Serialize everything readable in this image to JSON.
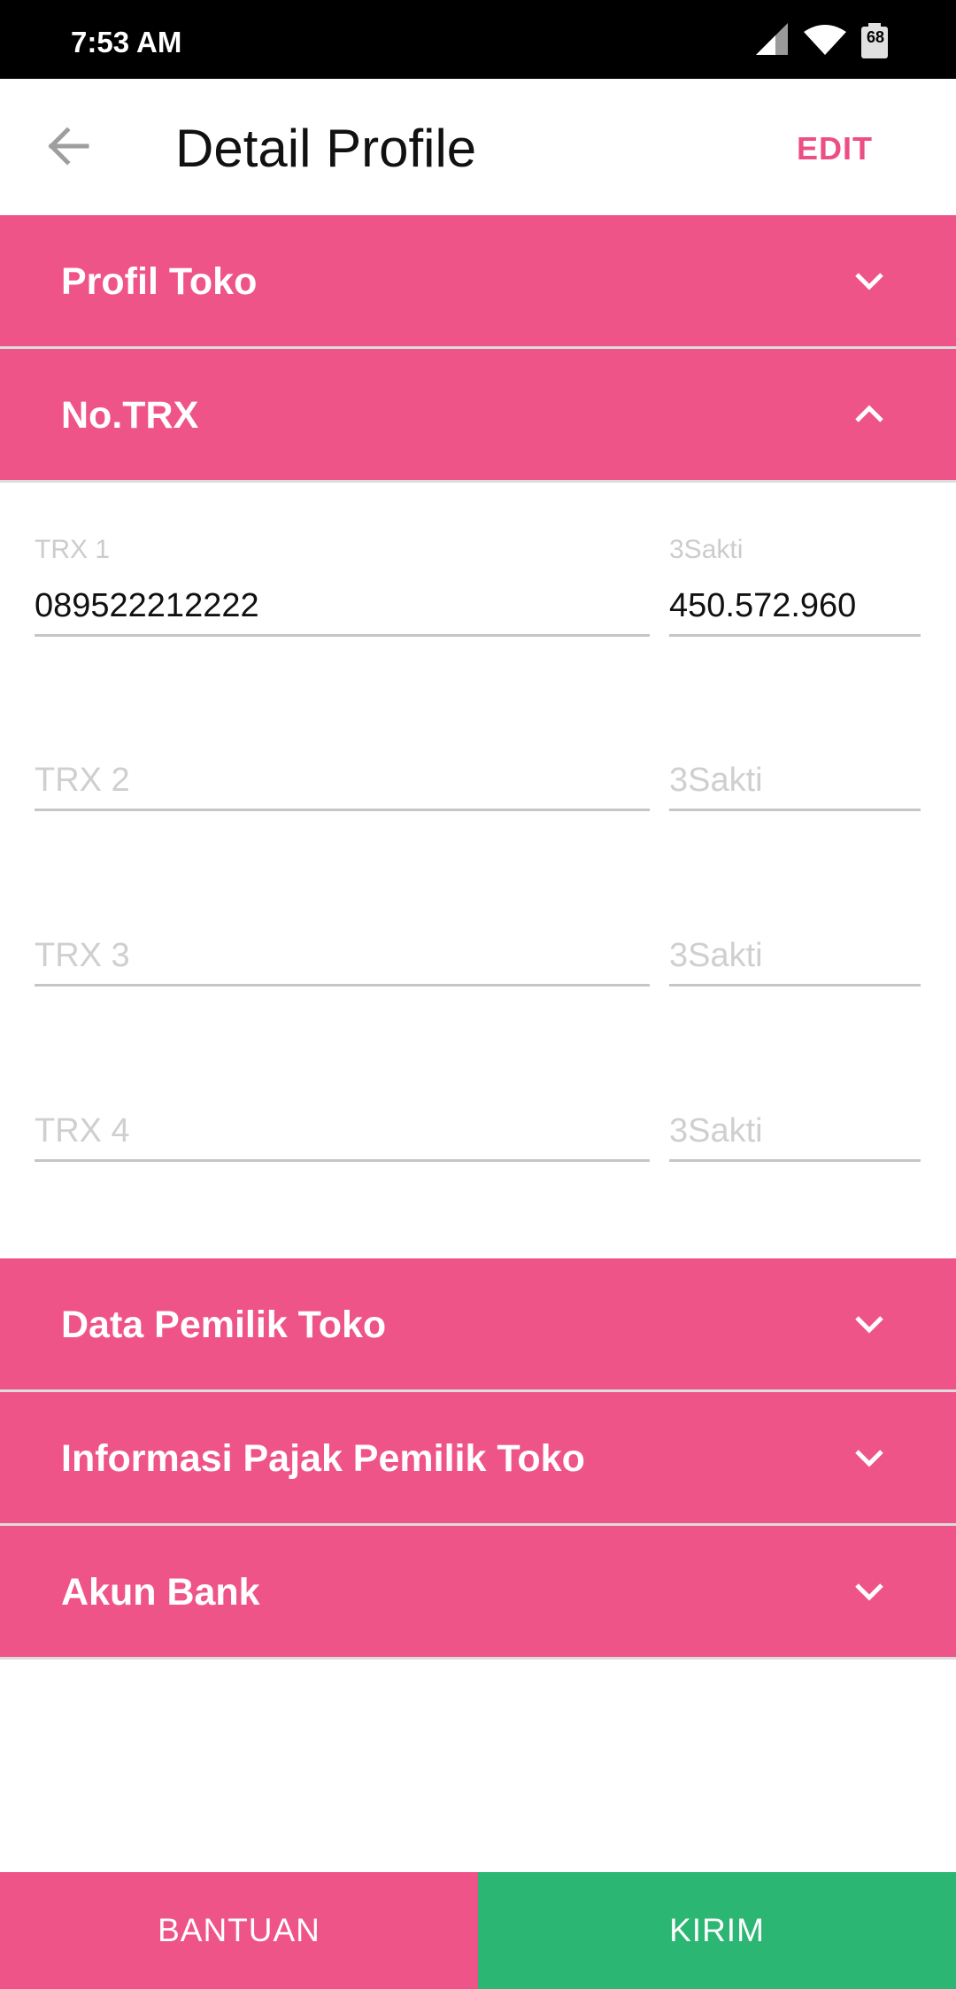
{
  "status": {
    "time": "7:53 AM",
    "battery": "68"
  },
  "header": {
    "title": "Detail Profile",
    "edit_label": "EDIT"
  },
  "sections": {
    "profil_toko": "Profil Toko",
    "no_trx": "No.TRX",
    "data_pemilik": "Data Pemilik Toko",
    "informasi_pajak": "Informasi Pajak Pemilik Toko",
    "akun_bank": "Akun Bank"
  },
  "trx": [
    {
      "label": "TRX 1",
      "value": "089522212222",
      "sakti_label": "3Sakti",
      "sakti_value": "450.572.960"
    },
    {
      "placeholder": "TRX 2",
      "sakti_placeholder": "3Sakti"
    },
    {
      "placeholder": "TRX 3",
      "sakti_placeholder": "3Sakti"
    },
    {
      "placeholder": "TRX 4",
      "sakti_placeholder": "3Sakti"
    }
  ],
  "footer": {
    "help_label": "BANTUAN",
    "send_label": "KIRIM"
  },
  "colors": {
    "accent": "#ef5488",
    "send": "#2bb673"
  }
}
